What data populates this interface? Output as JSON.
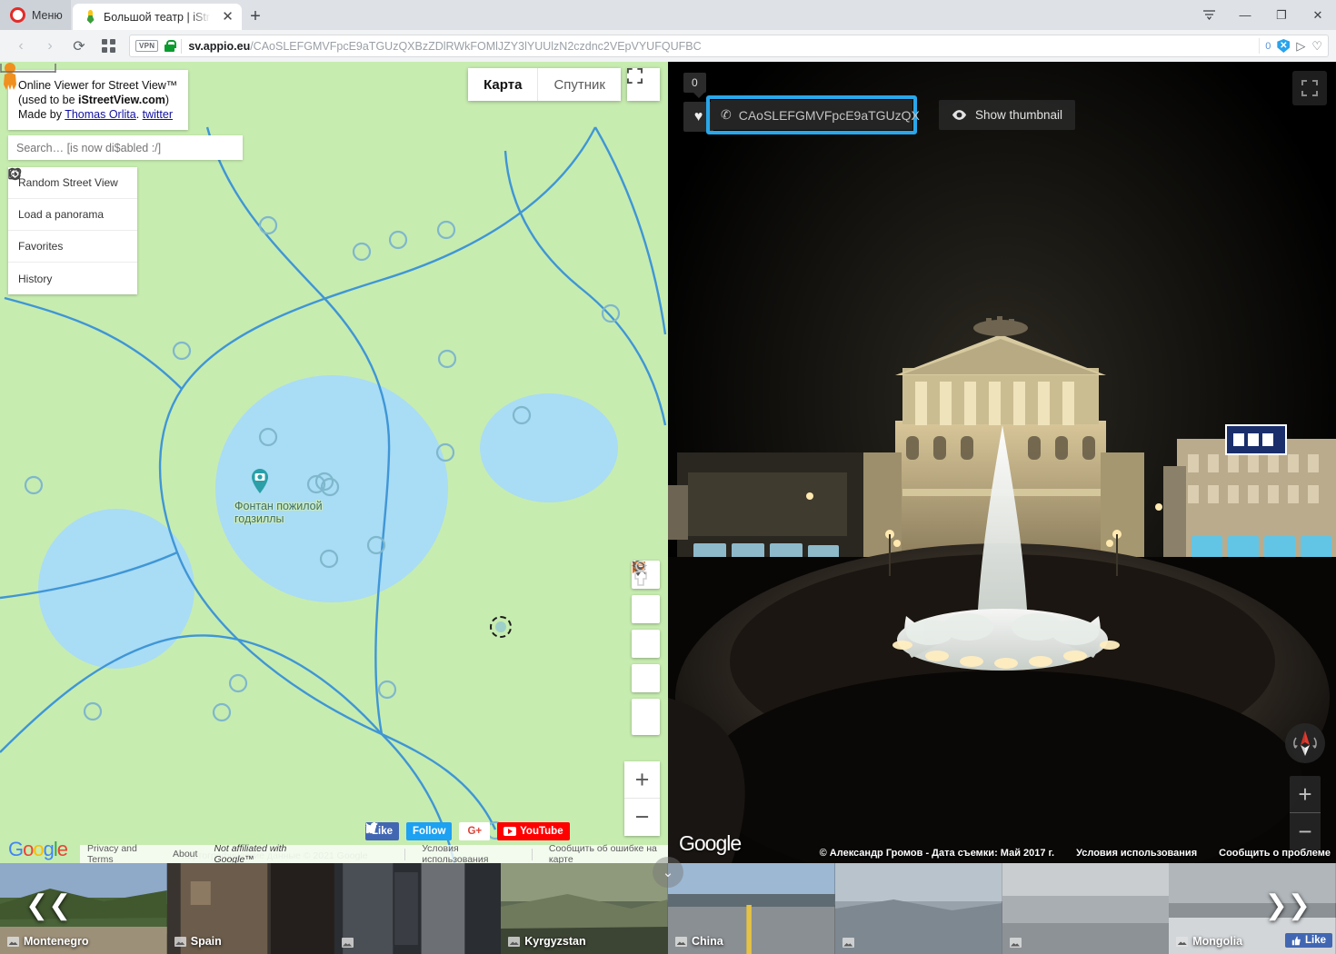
{
  "browser": {
    "menu_label": "Меню",
    "tab_title": "Большой театр | iStreetVi",
    "url_host": "sv.appio.eu",
    "url_path": "/CAoSLEFGMVFpcE9aTGUzQXBzZDlRWkFOMlJZY3lYUUlzN2czdnc2VEpVYUFQUFBC",
    "vpn_badge": "VPN",
    "blocker_count": "0",
    "blocker_glyph": "✕",
    "share_glyph": "▷",
    "heart_glyph": "♡",
    "back_glyph": "‹",
    "forward_glyph": "›",
    "reload_glyph": "⟳",
    "speeddial_glyph": "▦",
    "newtab_glyph": "+",
    "close_tab_glyph": "✕",
    "win_list_glyph": "≡",
    "win_minimize_glyph": "—",
    "win_maximize_glyph": "❐",
    "win_close_glyph": "✕"
  },
  "map": {
    "info": {
      "line1": "Online Viewer for Street View™",
      "line2_pre": "(used to be ",
      "line2_brand": "iStreetView.com",
      "line2_post": ")",
      "line3_pre": "Made by ",
      "author": "Thomas Orlita",
      "line3_mid": ". ",
      "twitter": "twitter"
    },
    "search_placeholder": "Search… [is now di$abled :/]",
    "menu_items": [
      {
        "label": "Random Street View",
        "icon": "refresh-icon"
      },
      {
        "label": "Load a panorama",
        "icon": "import-icon"
      },
      {
        "label": "Favorites",
        "icon": "heart-icon"
      },
      {
        "label": "History",
        "icon": "history-icon"
      }
    ],
    "maptype": {
      "map": "Карта",
      "satellite": "Спутник",
      "active": "Карта"
    },
    "marker_label": "Фонтан пожилой годзиллы",
    "tools": [
      {
        "name": "place-pin-icon"
      },
      {
        "name": "dollar-icon"
      },
      {
        "name": "speech-bubble-icon"
      },
      {
        "name": "layers-off-icon"
      },
      {
        "name": "pegman-icon"
      }
    ],
    "zoom_in": "+",
    "zoom_out": "−",
    "social": {
      "facebook": "Like",
      "twitter": "Follow",
      "google_plus": "G+",
      "youtube": "YouTube"
    },
    "footer": {
      "privacy": "Privacy and Terms",
      "about": "About",
      "not_affiliated": "Not affiliated with Google™",
      "terms": "Условия использования",
      "report": "Сообщить об ошибке на карте",
      "ghost_attribution": "Картографические данные © 2021 Google"
    },
    "google_logo": [
      "G",
      "o",
      "o",
      "g",
      "l",
      "e"
    ]
  },
  "pano": {
    "favorite_count": "0",
    "favorite_glyph": "♥",
    "pano_id": "CAoSLEFGMVFpcE9aTGUzQX",
    "link_glyph": "✆",
    "show_thumbnail": "Show thumbnail",
    "zoom_in": "+",
    "zoom_out": "−",
    "google_logo": "Google",
    "copyright": "© Александр Громов - Дата съемки: Май 2017 г.",
    "terms": "Условия использования",
    "report": "Сообщить о проблеме"
  },
  "filmstrip": {
    "prev_glyph": "❮❮",
    "next_glyph": "❯❯",
    "collapse_glyph": "⌄",
    "fb_like": "Like",
    "thumbs": [
      {
        "label": "Montenegro",
        "c1": "#8fa9c9",
        "c2": "#4a6338",
        "c3": "#9d9079"
      },
      {
        "label": "Spain",
        "c1": "#3a3430",
        "c2": "#6b5c4b",
        "c3": "#241f1c"
      },
      {
        "label": "",
        "c1": "#4a4e55",
        "c2": "#2a2d31",
        "c3": "#6c6f74"
      },
      {
        "label": "Kyrgyzstan",
        "c1": "#5e6a53",
        "c2": "#8e9a7b",
        "c3": "#3c4434"
      },
      {
        "label": "China",
        "c1": "#9db8d2",
        "c2": "#5f6b72",
        "c3": "#8a8f93"
      },
      {
        "label": "",
        "c1": "#b9c3cb",
        "c2": "#7e8891",
        "c3": "#98a2ab"
      },
      {
        "label": "",
        "c1": "#c9cdd0",
        "c2": "#a9aeb2",
        "c3": "#8d9296"
      },
      {
        "label": "Mongolia",
        "c1": "#b0b6ba",
        "c2": "#8b9195",
        "c3": "#d2d6d9"
      }
    ]
  },
  "colors": {
    "accent_blue": "#29a7ea",
    "map_land": "#c7ecb0",
    "map_water": "#a9dcf5",
    "map_road": "#3f96d6",
    "pegman_orange": "#f0901f"
  }
}
